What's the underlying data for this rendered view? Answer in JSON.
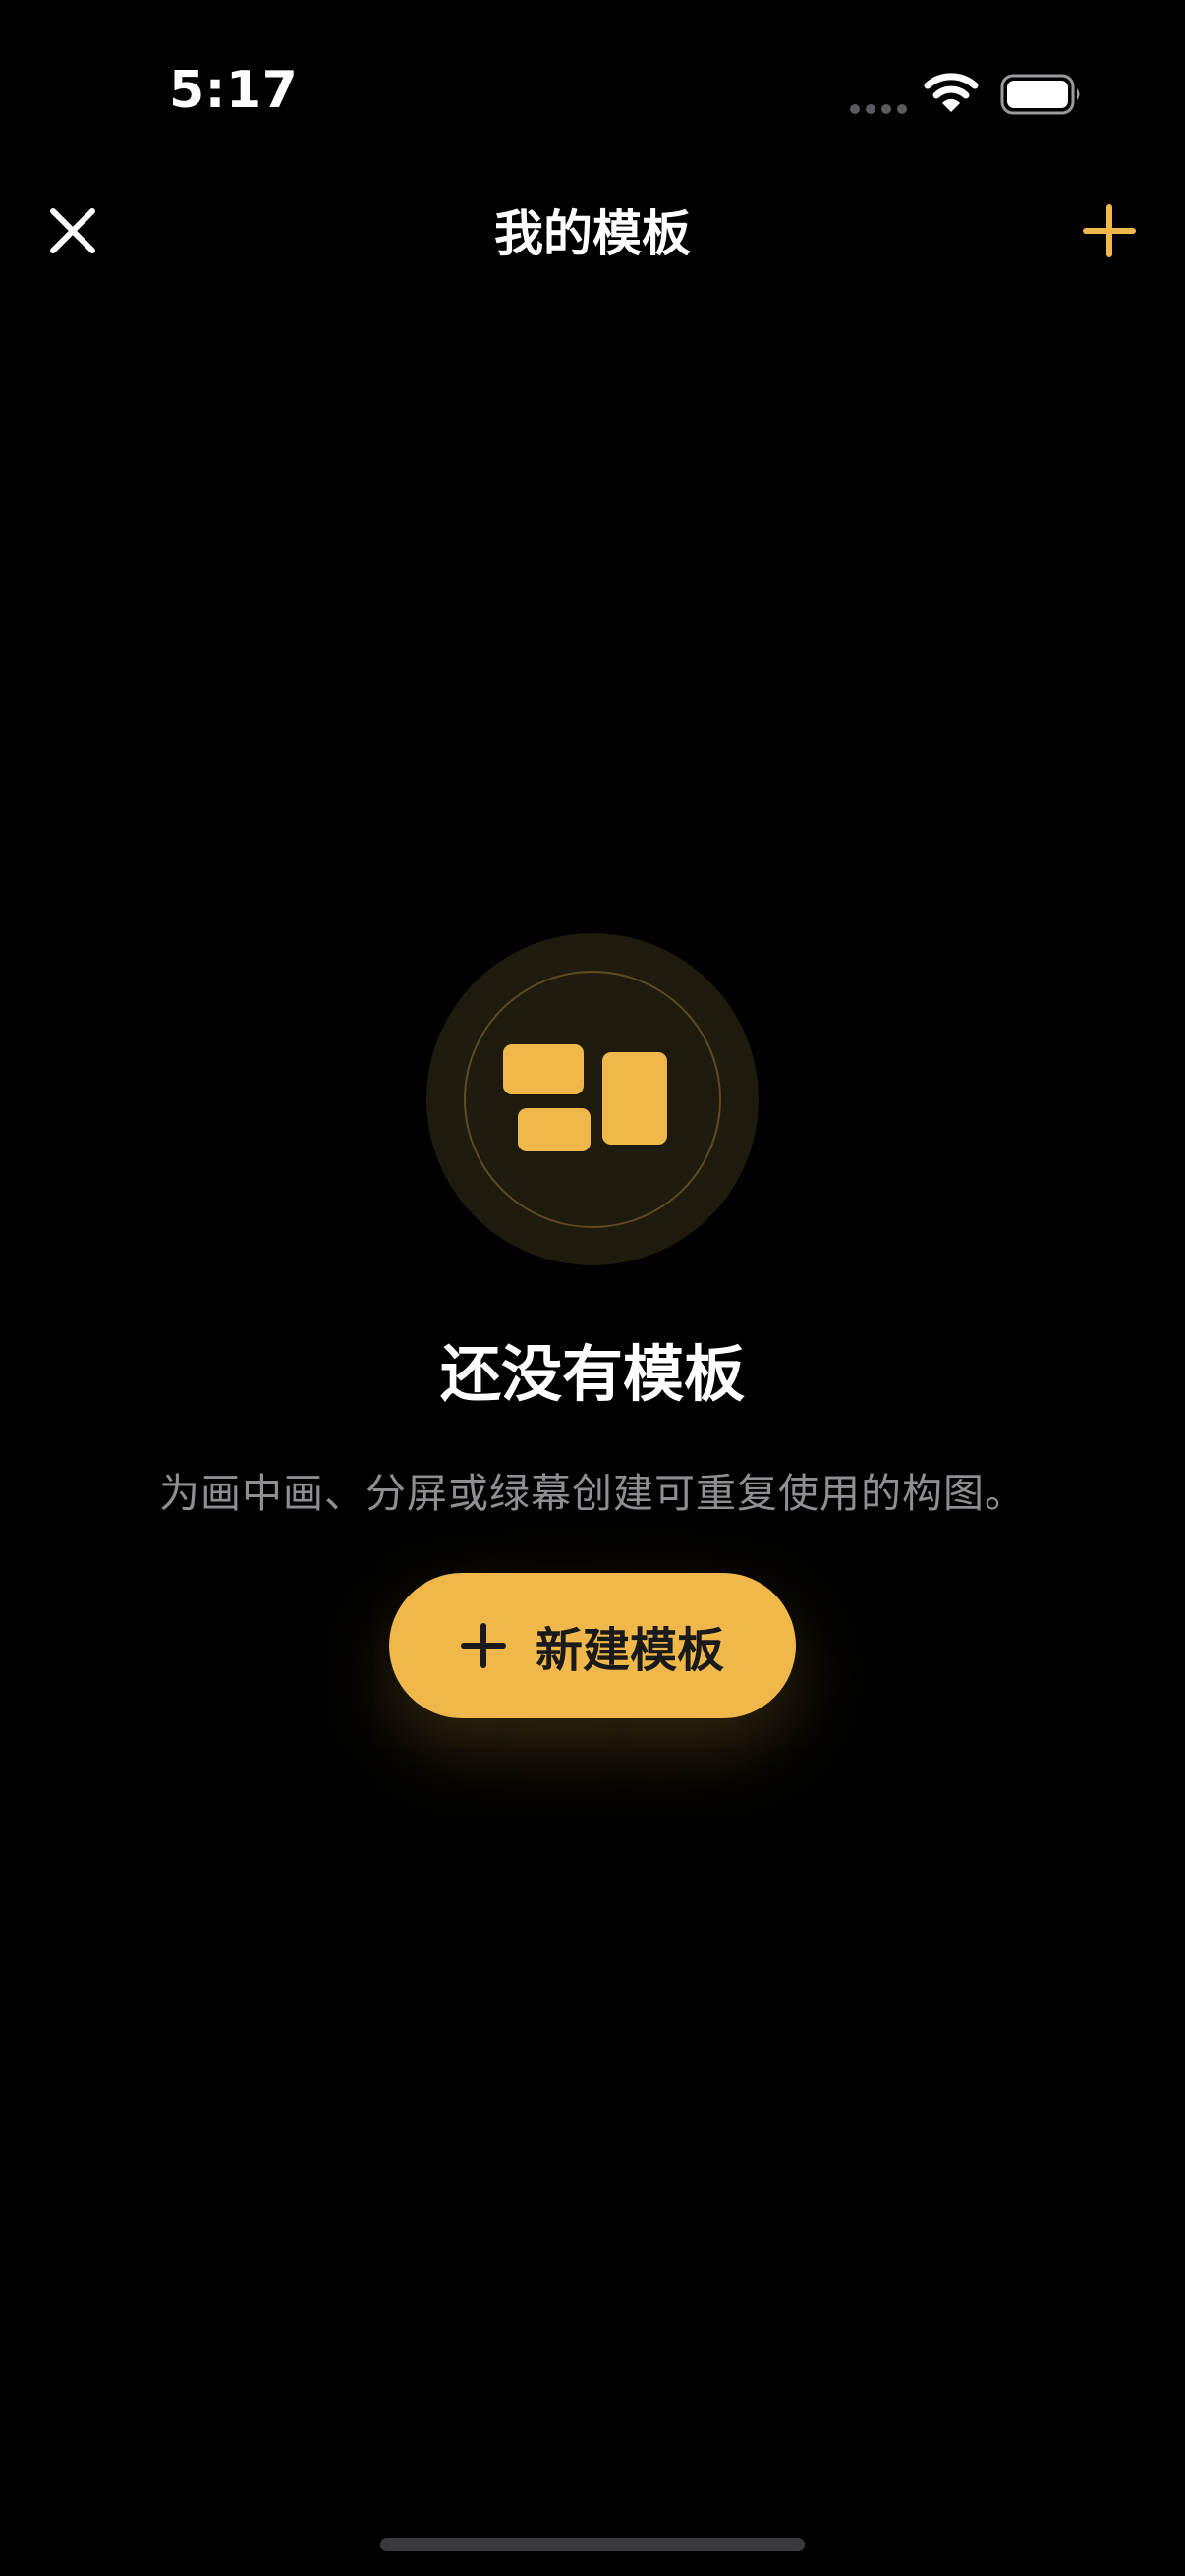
{
  "status_bar": {
    "time": "5:17",
    "icons": [
      "signal-dots-icon",
      "wifi-icon",
      "battery-icon"
    ]
  },
  "nav": {
    "title": "我的模板",
    "close_icon": "close-icon",
    "add_icon": "plus-icon"
  },
  "empty_state": {
    "icon": "layout-grid-icon",
    "title": "还没有模板",
    "description": "为画中画、分屏或绿幕创建可重复使用的构图。",
    "button_label": "新建模板",
    "button_icon": "plus-icon"
  },
  "colors": {
    "background": "#000000",
    "accent": "#f0b84a",
    "text_primary": "#ffffff",
    "text_secondary": "#8e8e93"
  }
}
